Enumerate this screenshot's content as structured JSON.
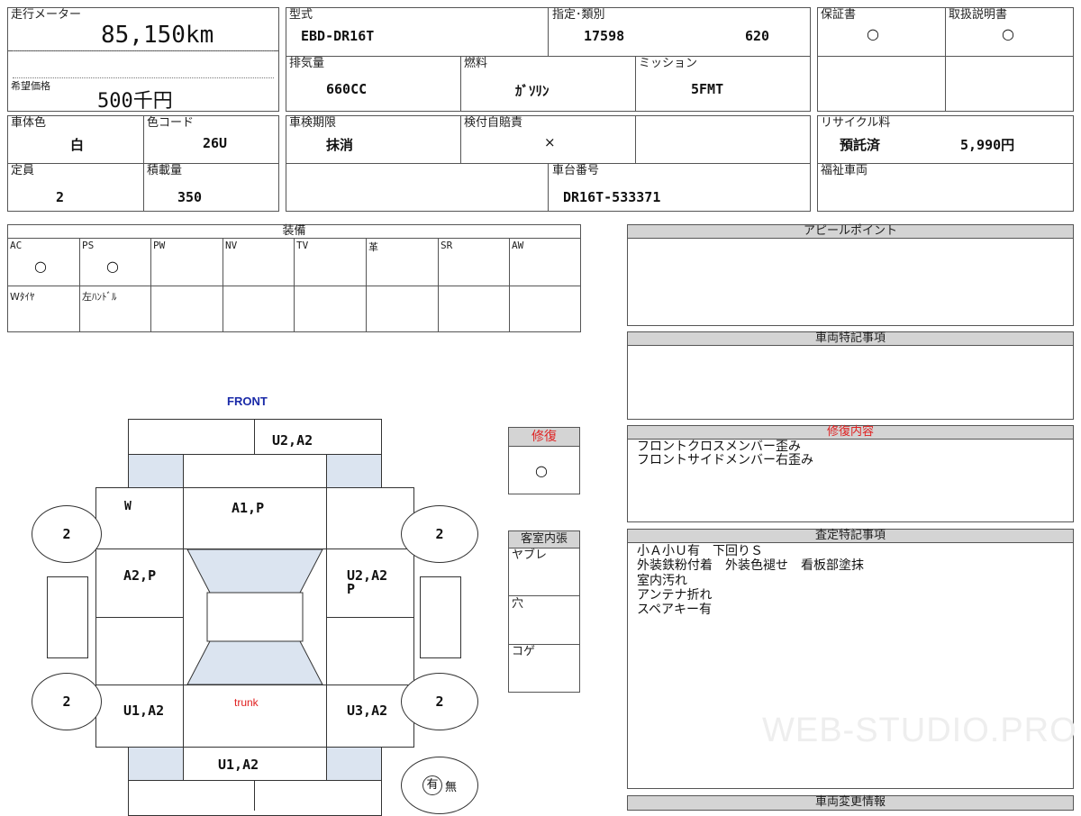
{
  "vehicle": {
    "mileage_label": "走行メーター",
    "mileage": "85,150km",
    "price_label": "希望価格",
    "price": "500千円",
    "model_label": "型式",
    "model": "EBD-DR16T",
    "designation_label": "指定･類別",
    "designation_no": "17598",
    "class_no": "620",
    "warranty_label": "保証書",
    "warranty": "○",
    "manual_label": "取扱説明書",
    "manual": "○",
    "displacement_label": "排気量",
    "displacement": "660CC",
    "fuel_label": "燃料",
    "fuel": "ｶﾞｿﾘﾝ",
    "transmission_label": "ミッション",
    "transmission": "5FMT",
    "body_color_label": "車体色",
    "body_color": "白",
    "color_code_label": "色コード",
    "color_code": "26U",
    "inspection_label": "車検期限",
    "inspection": "抹消",
    "liability_label": "検付自賠責",
    "liability": "×",
    "recycle_label": "リサイクル料",
    "recycle_status": "預託済",
    "recycle_fee": "5,990円",
    "capacity_label": "定員",
    "capacity": "2",
    "load_label": "積載量",
    "load": "350",
    "chassis_label": "車台番号",
    "chassis": "DR16T-533371",
    "welfare_label": "福祉車両"
  },
  "equipment": {
    "title": "装備",
    "row1": [
      {
        "label": "AC",
        "value": "○"
      },
      {
        "label": "PS",
        "value": "○"
      },
      {
        "label": "PW",
        "value": ""
      },
      {
        "label": "NV",
        "value": ""
      },
      {
        "label": "TV",
        "value": ""
      },
      {
        "label": "革",
        "value": ""
      },
      {
        "label": "SR",
        "value": ""
      },
      {
        "label": "AW",
        "value": ""
      }
    ],
    "row2": [
      {
        "label": "Wﾀｲﾔ"
      },
      {
        "label": "左ﾊﾝﾄﾞﾙ"
      },
      {
        "label": ""
      },
      {
        "label": ""
      },
      {
        "label": ""
      },
      {
        "label": ""
      },
      {
        "label": ""
      }
    ]
  },
  "diagram": {
    "front_label": "FRONT",
    "trunk_label": "trunk",
    "tire_fl": "2",
    "tire_fr": "2",
    "tire_rl": "2",
    "tire_rr": "2",
    "front_bumper": "U2,A2",
    "windshield_mark": "W",
    "hood": "A1,P",
    "left_front": "A2,P",
    "right_front_line1": "U2,A2",
    "right_front_line2": "P",
    "left_rear": "U1,A2",
    "right_rear": "U3,A2",
    "rear_bumper": "U1,A2",
    "spare_yes": "有",
    "spare_no": "無"
  },
  "repair": {
    "title": "修復",
    "value": "○"
  },
  "interior": {
    "title": "客室内張",
    "items": [
      "ヤブレ",
      "穴",
      "コゲ"
    ]
  },
  "notes": {
    "appeal_title": "アピールポイント",
    "special_title": "車両特記事項",
    "repair_content_title": "修復内容",
    "repair_content": [
      "フロントクロスメンバー歪み",
      "フロントサイドメンバー右歪み"
    ],
    "assessment_title": "査定特記事項",
    "assessment": [
      "小Ａ小Ｕ有　下回りＳ",
      "外装鉄粉付着　外装色褪せ　看板部塗抹",
      "室内汚れ",
      "アンテナ折れ",
      "スペアキー有"
    ],
    "change_title": "車両変更情報"
  },
  "watermark": "WEB-STUDIO.PRO",
  "colors": {
    "repair_red": "#e02020",
    "front_blue": "#1a2aa8",
    "trunk_red": "#e02020",
    "glass_blue": "#dbe4f0",
    "header_gray": "#d4d4d4"
  }
}
